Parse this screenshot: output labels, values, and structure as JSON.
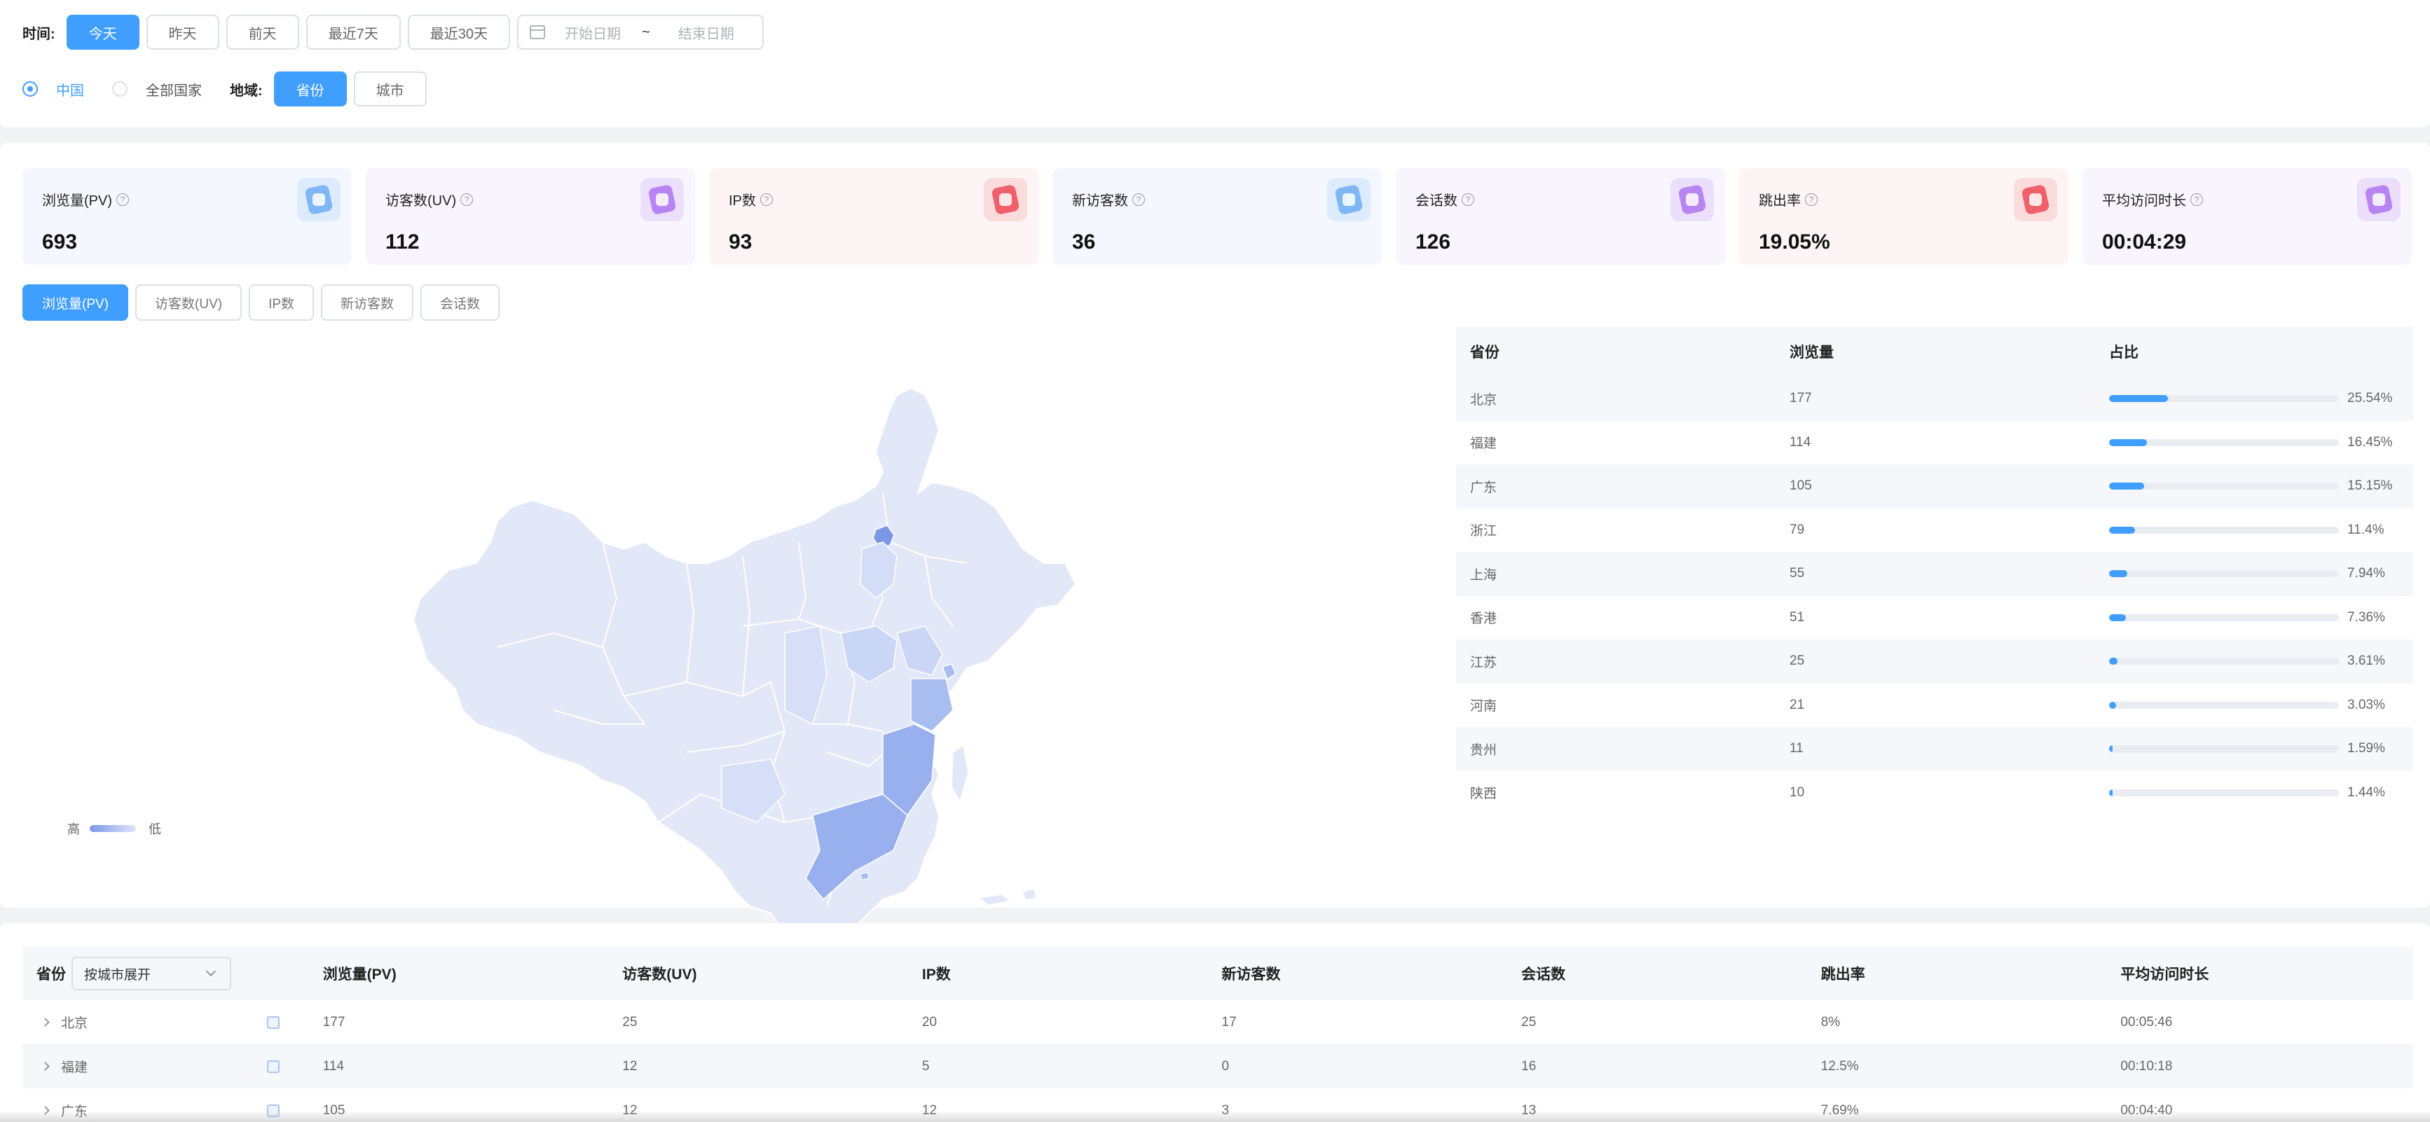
{
  "filters": {
    "time_label": "时间:",
    "time_buttons": [
      "今天",
      "昨天",
      "前天",
      "最近7天",
      "最近30天"
    ],
    "active_time": "今天",
    "start_placeholder": "开始日期",
    "end_placeholder": "结束日期",
    "range_separator": "~",
    "scope_options": [
      "中国",
      "全部国家"
    ],
    "selected_scope": "中国",
    "region_label": "地域:",
    "region_buttons": [
      "省份",
      "城市"
    ],
    "active_region": "省份"
  },
  "stats": [
    {
      "name": "浏览量(PV)",
      "value": "693"
    },
    {
      "name": "访客数(UV)",
      "value": "112"
    },
    {
      "name": "IP数",
      "value": "93"
    },
    {
      "name": "新访客数",
      "value": "36"
    },
    {
      "name": "会话数",
      "value": "126"
    },
    {
      "name": "跳出率",
      "value": "19.05%"
    },
    {
      "name": "平均访问时长",
      "value": "00:04:29"
    }
  ],
  "help_icon_text": "?",
  "metric_tabs": [
    "浏览量(PV)",
    "访客数(UV)",
    "IP数",
    "新访客数",
    "会话数"
  ],
  "active_metric": "浏览量(PV)",
  "map": {
    "legend_high": "高",
    "legend_low": "低",
    "colors": {
      "base": "#e3e8f9",
      "low": "#c9d5f5",
      "mid": "#a8bdf0",
      "high": "#7b98e6"
    }
  },
  "rank_table": {
    "headers": [
      "省份",
      "浏览量",
      "占比"
    ],
    "rows": [
      {
        "province": "北京",
        "pv": "177",
        "ratio": "25.54%",
        "pct": 25.54
      },
      {
        "province": "福建",
        "pv": "114",
        "ratio": "16.45%",
        "pct": 16.45
      },
      {
        "province": "广东",
        "pv": "105",
        "ratio": "15.15%",
        "pct": 15.15
      },
      {
        "province": "浙江",
        "pv": "79",
        "ratio": "11.4%",
        "pct": 11.4
      },
      {
        "province": "上海",
        "pv": "55",
        "ratio": "7.94%",
        "pct": 7.94
      },
      {
        "province": "香港",
        "pv": "51",
        "ratio": "7.36%",
        "pct": 7.36
      },
      {
        "province": "江苏",
        "pv": "25",
        "ratio": "3.61%",
        "pct": 3.61
      },
      {
        "province": "河南",
        "pv": "21",
        "ratio": "3.03%",
        "pct": 3.03
      },
      {
        "province": "贵州",
        "pv": "11",
        "ratio": "1.59%",
        "pct": 1.59
      },
      {
        "province": "陕西",
        "pv": "10",
        "ratio": "1.44%",
        "pct": 1.44
      }
    ]
  },
  "detail_table": {
    "first_header": "省份",
    "expand_select": "按城市展开",
    "headers": [
      "浏览量(PV)",
      "访客数(UV)",
      "IP数",
      "新访客数",
      "会话数",
      "跳出率",
      "平均访问时长"
    ],
    "rows": [
      {
        "province": "北京",
        "cells": [
          "177",
          "25",
          "20",
          "17",
          "25",
          "8%",
          "00:05:46"
        ]
      },
      {
        "province": "福建",
        "cells": [
          "114",
          "12",
          "5",
          "0",
          "16",
          "12.5%",
          "00:10:18"
        ]
      },
      {
        "province": "广东",
        "cells": [
          "105",
          "12",
          "12",
          "3",
          "13",
          "7.69%",
          "00:04:40"
        ]
      }
    ]
  },
  "accent_color": "#409eff"
}
